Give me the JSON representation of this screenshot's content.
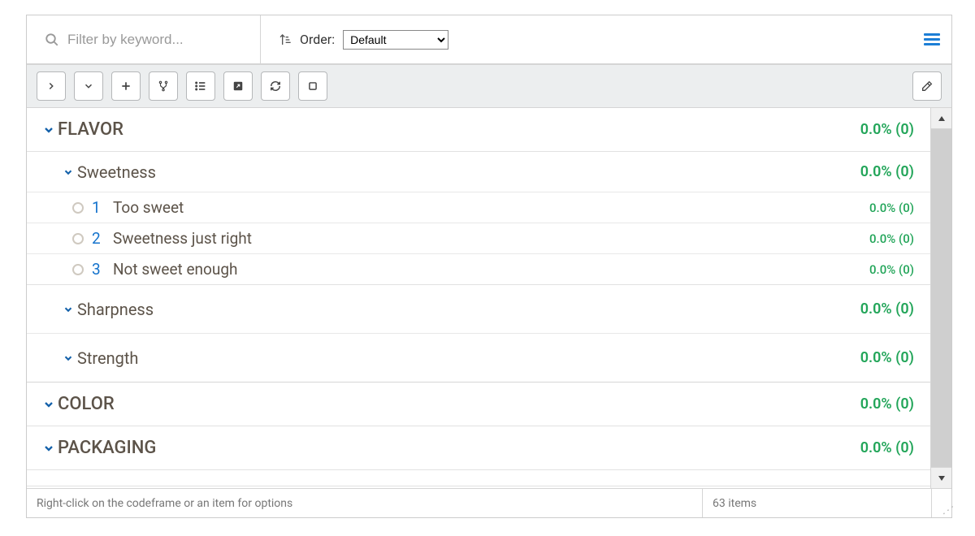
{
  "filter": {
    "placeholder": "Filter by keyword..."
  },
  "order": {
    "label": "Order:",
    "selected": "Default",
    "options": [
      "Default"
    ]
  },
  "toolbar": {},
  "tree": {
    "categories": [
      {
        "label": "FLAVOR",
        "metric": "0.0% (0)",
        "subs": [
          {
            "label": "Sweetness",
            "metric": "0.0% (0)",
            "codes": [
              {
                "num": "1",
                "label": "Too sweet",
                "metric": "0.0% (0)"
              },
              {
                "num": "2",
                "label": "Sweetness just right",
                "metric": "0.0% (0)"
              },
              {
                "num": "3",
                "label": "Not sweet enough",
                "metric": "0.0% (0)"
              }
            ]
          },
          {
            "label": "Sharpness",
            "metric": "0.0% (0)",
            "codes": []
          },
          {
            "label": "Strength",
            "metric": "0.0% (0)",
            "codes": []
          }
        ]
      },
      {
        "label": "COLOR",
        "metric": "0.0% (0)",
        "subs": []
      },
      {
        "label": "PACKAGING",
        "metric": "0.0% (0)",
        "subs": []
      }
    ]
  },
  "status": {
    "hint": "Right-click on the codeframe or an item for options",
    "count": "63 items"
  }
}
